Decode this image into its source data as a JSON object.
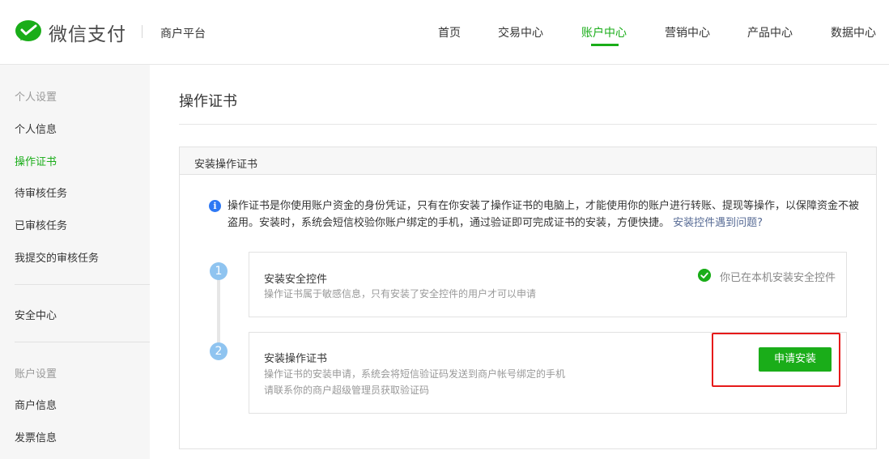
{
  "header": {
    "brand": "微信支付",
    "sub": "商户平台",
    "nav": [
      {
        "label": "首页"
      },
      {
        "label": "交易中心"
      },
      {
        "label": "账户中心",
        "active": true
      },
      {
        "label": "营销中心"
      },
      {
        "label": "产品中心"
      },
      {
        "label": "数据中心"
      }
    ]
  },
  "sidebar": {
    "items": [
      {
        "label": "个人设置",
        "type": "group"
      },
      {
        "label": "个人信息"
      },
      {
        "label": "操作证书",
        "active": true
      },
      {
        "label": "待审核任务"
      },
      {
        "label": "已审核任务"
      },
      {
        "label": "我提交的审核任务"
      },
      {
        "label": "安全中心"
      },
      {
        "label": "账户设置",
        "type": "group"
      },
      {
        "label": "商户信息"
      },
      {
        "label": "发票信息"
      }
    ]
  },
  "main": {
    "title": "操作证书",
    "panel": {
      "heading": "安装操作证书",
      "info_icon": "info-icon",
      "info_text": "操作证书是你使用账户资金的身份凭证，只有在你安装了操作证书的电脑上，才能使用你的账户进行转账、提现等操作，以保障资金不被盗用。安装时，系统会短信校验你账户绑定的手机，通过验证即可完成证书的安装，方便快捷。",
      "info_link": "安装控件遇到问题?",
      "steps": [
        {
          "number": "1",
          "title": "安装安全控件",
          "desc": [
            "操作证书属于敏感信息，只有安装了安全控件的用户才可以申请"
          ],
          "status_icon": "check-circle-icon",
          "status_text": "你已在本机安装安全控件"
        },
        {
          "number": "2",
          "title": "安装操作证书",
          "desc": [
            "操作证书的安装申请，系统会将短信验证码发送到商户帐号绑定的手机",
            "请联系你的商户超级管理员获取验证码"
          ],
          "button": "申请安装"
        }
      ]
    }
  },
  "colors": {
    "accent": "#1aad19",
    "link": "#576b95",
    "info": "#2d78f4",
    "highlight": "#e61a1a",
    "step": "#8fc4f0"
  }
}
